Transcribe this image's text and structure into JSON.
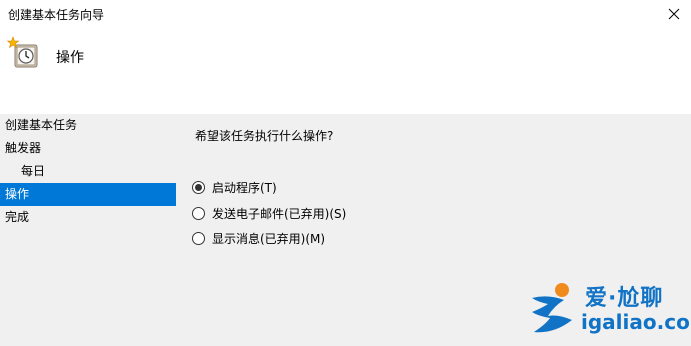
{
  "window": {
    "title": "创建基本任务向导",
    "close_glyph": "✕"
  },
  "header": {
    "icon": "task-scheduler-clock-icon",
    "title": "操作"
  },
  "sidebar": {
    "steps": [
      {
        "label": "创建基本任务",
        "active": false
      },
      {
        "label": "触发器",
        "active": false
      },
      {
        "label": "每日",
        "active": false
      },
      {
        "label": "操作",
        "active": true
      },
      {
        "label": "完成",
        "active": false
      }
    ]
  },
  "main": {
    "question": "希望该任务执行什么操作?",
    "options": [
      {
        "label": "启动程序(T)",
        "checked": true
      },
      {
        "label": "发送电子邮件(已弃用)(S)",
        "checked": false
      },
      {
        "label": "显示消息(已弃用)(M)",
        "checked": false
      }
    ]
  },
  "watermark": {
    "top": "爱·尬聊",
    "bottom": "igaliao.com",
    "color": "#1173c6",
    "accent": "#f08a1c"
  },
  "colors": {
    "active_step": "#0078d7",
    "content_bg": "#f0f0f0"
  }
}
